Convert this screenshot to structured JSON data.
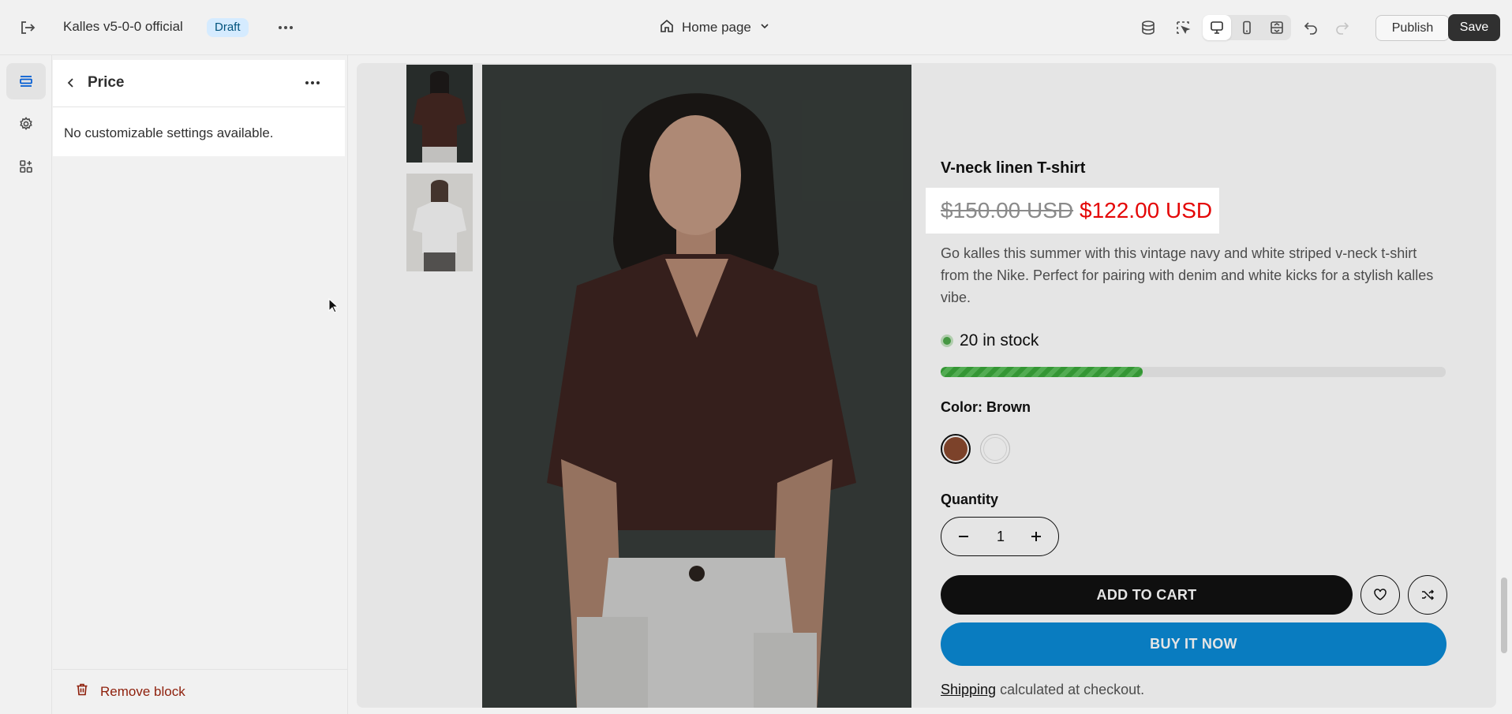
{
  "topbar": {
    "store_name": "Kalles v5-0-0 official",
    "status_badge": "Draft",
    "page_selector": "Home page",
    "publish_label": "Publish",
    "save_label": "Save"
  },
  "panel": {
    "title": "Price",
    "message": "No customizable settings available.",
    "remove_label": "Remove block"
  },
  "product": {
    "title": "V-neck linen T-shirt",
    "price_compare": "$150.00 USD",
    "price_sale": "$122.00 USD",
    "description": "Go kalles this summer with this vintage navy and white striped v-neck t-shirt from the Nike. Perfect for pairing with denim and white kicks for a stylish kalles vibe.",
    "stock_text": "20 in stock",
    "stock_level": 0.4,
    "color_label": "Color: Brown",
    "quantity_label": "Quantity",
    "quantity_value": "1",
    "add_to_cart": "ADD TO CART",
    "buy_now": "BUY IT NOW",
    "shipping_link": "Shipping",
    "shipping_rest": " calculated at checkout."
  },
  "colors": {
    "accent": "#005bd3",
    "sale_price": "#e40606",
    "buy_button": "#0b8bd6",
    "remove": "#8e1f0b",
    "swatch_brown": "#8b4a2f",
    "swatch_white": "#ffffff"
  }
}
